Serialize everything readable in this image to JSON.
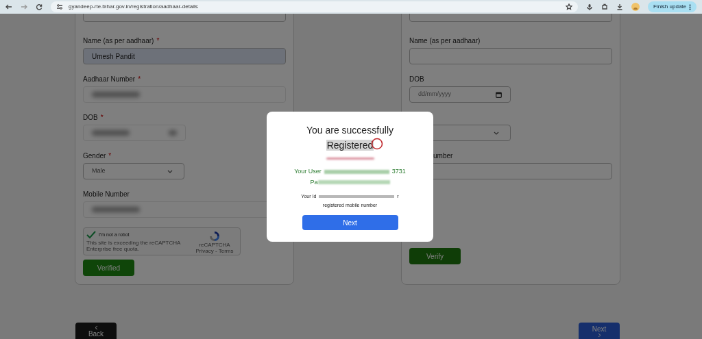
{
  "browser": {
    "url": "gyandeep-rte.bihar.gov.in/registration/aadhaar-details",
    "update_button": "Finish update"
  },
  "left_form": {
    "fields": [
      {
        "kind": "text",
        "label": "Name (as per aadhaar)",
        "required_mark": "*",
        "value": "Umesh Pandit",
        "autofilled": true
      },
      {
        "kind": "redacted",
        "label": "Aadhaar Number",
        "required_mark": "*"
      },
      {
        "kind": "redacted_date",
        "label": "DOB",
        "required_mark": "*"
      },
      {
        "kind": "select",
        "label": "Gender",
        "required_mark": "*",
        "value": "Male"
      },
      {
        "kind": "redacted",
        "label": "Mobile Number"
      }
    ],
    "captcha": {
      "label": "I'm not a robot",
      "checked": true,
      "note": "This site is exceeding the reCAPTCHA Enterprise free quota.",
      "brand": "reCAPTCHA",
      "links": "Privacy - Terms"
    },
    "button": "Verified"
  },
  "right_form": {
    "fields": [
      {
        "kind": "text",
        "label": "Name (as per aadhaar)",
        "autofilled": false
      },
      {
        "kind": "date",
        "label": "DOB",
        "placeholder": "dd/mm/yyyy"
      },
      {
        "kind": "select"
      },
      {
        "kind": "text",
        "label": "umber",
        "autofilled": false
      }
    ],
    "button": "Verify"
  },
  "modal": {
    "title_lines": [
      "You are successfully",
      "Registered"
    ],
    "user_prefix": "Your User",
    "user_suffix": "3731",
    "password_prefix": "Pa",
    "id_prefix": "Your Id",
    "id_suffix": "r",
    "note": "registered mobile number",
    "button": "Next"
  },
  "nav": {
    "back": "Back",
    "next": "Next"
  }
}
